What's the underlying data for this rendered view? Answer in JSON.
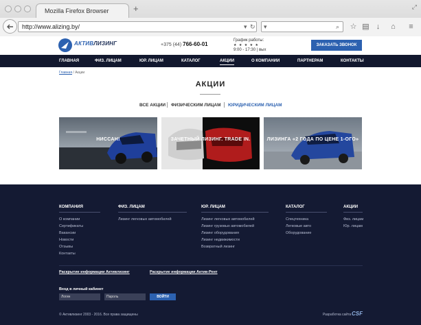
{
  "browser": {
    "tab_title": "Mozilla Firefox Browser",
    "new_tab": "+",
    "url": "http://www.alizing.by/"
  },
  "header": {
    "logo_a": "АКТИВ",
    "logo_b": "ЛИЗИНГ",
    "phone_prefix": "+375 (44)",
    "phone_number": "766-60-01",
    "hours_title": "График работы:",
    "hours_stars": "★ ★ ★ ★ ★",
    "hours_time": "9:00 - 17:30",
    "hours_weekend": "вых",
    "call_button": "ЗАКАЗАТЬ ЗВОНОК"
  },
  "menu": [
    "ГЛАВНАЯ",
    "ФИЗ. ЛИЦАМ",
    "ЮР. ЛИЦАМ",
    "КАТАЛОГ",
    "АКЦИИ",
    "О КОМПАНИИ",
    "ПАРТНЕРАМ",
    "КОНТАКТЫ"
  ],
  "breadcrumbs": {
    "home": "Главная",
    "sep": " / ",
    "current": "Акции"
  },
  "page_title": "АКЦИИ",
  "filters": [
    "ВСЕ АКЦИИ",
    "ФИЗИЧЕСКИМ ЛИЦАМ",
    "ЮРИДИЧЕСКИМ ЛИЦАМ"
  ],
  "promos": [
    "НИССАН!",
    "ЗАЧЕТНЫЙ ЛИЗИНГ. TRADE IN.",
    "ЛИЗИНГА «2 ГОДА ПО ЦЕНЕ 1-ОГО»"
  ],
  "footer": {
    "columns": [
      {
        "title": "КОМПАНИЯ",
        "links": [
          "О компании",
          "Сертификаты",
          "Вакансии",
          "Новости",
          "Отзывы",
          "Контакты"
        ]
      },
      {
        "title": "ФИЗ. ЛИЦАМ",
        "links": [
          "Лизинг легковых автомобилей"
        ]
      },
      {
        "title": "ЮР. ЛИЦАМ",
        "links": [
          "Лизинг легковых автомобилей",
          "Лизинг грузовых автомобилей",
          "Лизинг оборудования",
          "Лизинг недвижимости",
          "Возвратный лизинг"
        ]
      },
      {
        "title": "КАТАЛОГ",
        "links": [
          "Спецтехника",
          "Легковые авто",
          "Оборудование"
        ]
      },
      {
        "title": "АКЦИИ",
        "links": [
          "Физ. лицам",
          "Юр. лицам"
        ]
      }
    ],
    "disclosure_1": "Раскрытие информации Активлизинг",
    "disclosure_2": "Раскрытие информации Актив-Рент",
    "login_label": "Вход в личный кабинет",
    "login_placeholder": "Логин",
    "password_placeholder": "Пароль",
    "login_button": "ВОЙТИ",
    "copyright": "© Активлизинг 2003 - 2016. Все права защищены",
    "developer": "Разработка сайта",
    "developer_logo": "CSF"
  },
  "colors": {
    "brand_blue": "#2c61b0",
    "nav_dark": "#12182e",
    "footer_bg": "#141a33"
  }
}
